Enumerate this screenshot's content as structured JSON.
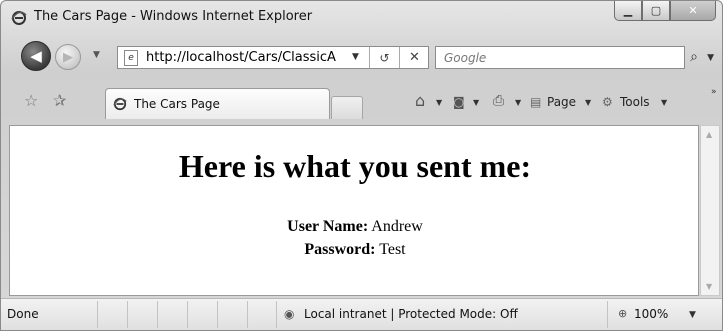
{
  "window": {
    "title": "The Cars Page - Windows Internet Explorer",
    "min_glyph": "▁",
    "max_glyph": "▢",
    "close_glyph": "✕"
  },
  "nav": {
    "back_glyph": "◀",
    "forward_glyph": "▶",
    "dropdown_glyph": "▼",
    "url": "http://localhost/Cars/ClassicA",
    "refresh_glyph": "↺",
    "stop_glyph": "✕",
    "search_placeholder": "Google",
    "search_glyph": "⌕"
  },
  "tabs": {
    "favorites_glyph": "☆",
    "add_favorites_glyph": "✰",
    "active_tab_label": "The Cars Page"
  },
  "commands": {
    "home_glyph": "⌂",
    "feeds_glyph": "◙",
    "print_glyph": "⎙",
    "page_label": "Page",
    "tools_label": "Tools",
    "more_glyph": "»"
  },
  "page": {
    "heading": "Here is what you sent me:",
    "fields": [
      {
        "label": "User Name:",
        "value": "Andrew"
      },
      {
        "label": "Password:",
        "value": "Test"
      }
    ]
  },
  "status": {
    "text": "Done",
    "zone": "Local intranet | Protected Mode: Off",
    "zoom": "100%"
  }
}
